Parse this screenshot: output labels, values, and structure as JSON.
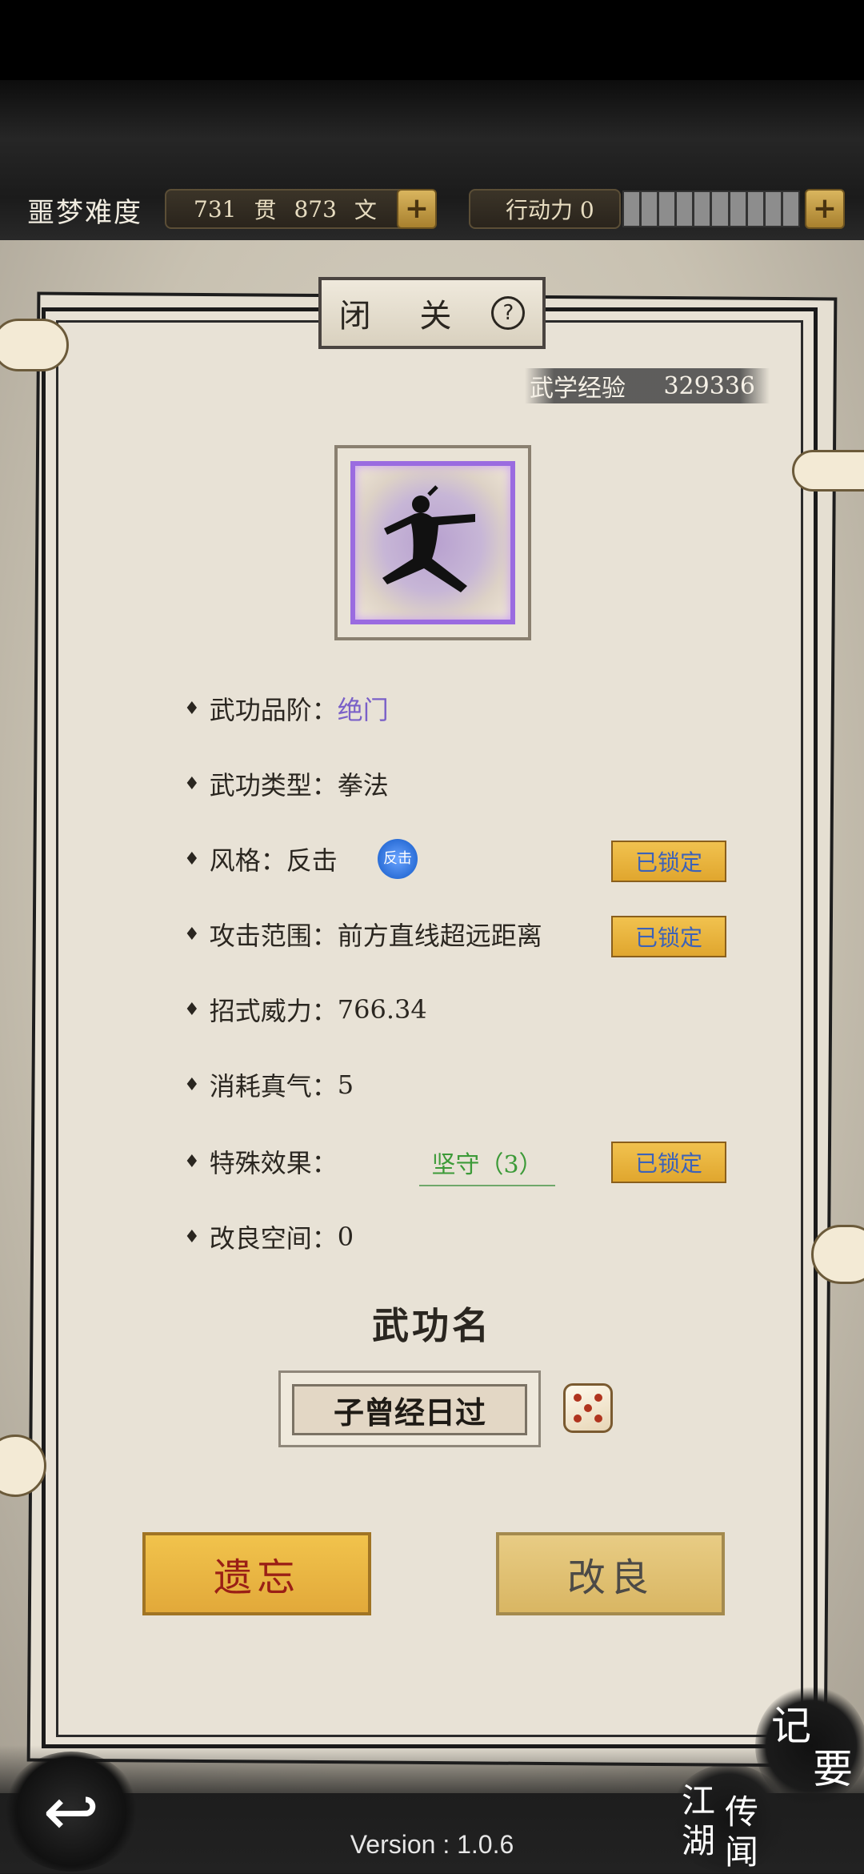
{
  "header": {
    "difficulty": "噩梦难度",
    "money": {
      "guan": "731",
      "guan_unit": "贯",
      "wen": "873",
      "wen_unit": "文"
    },
    "action_points_label": "行动力 0",
    "plus_icon": "+"
  },
  "panel": {
    "title": "闭 关",
    "help_icon": "?",
    "exp_label": "武学经验",
    "exp_value": "329336"
  },
  "attributes": [
    {
      "label": "武功品阶：",
      "value": "绝门"
    },
    {
      "label": "武功类型：",
      "value": "拳法"
    },
    {
      "label": "风格：",
      "value": "反击"
    },
    {
      "label": "攻击范围：",
      "value": "前方直线超远距离"
    },
    {
      "label": "招式威力：",
      "value": "766.34"
    },
    {
      "label": "消耗真气：",
      "value": "5"
    },
    {
      "label": "特殊效果：",
      "value": ""
    },
    {
      "label": "改良空间：",
      "value": "0"
    }
  ],
  "style_badge": "反击",
  "special_effect": "坚守（3）",
  "locked_label": "已锁定",
  "skill_name": {
    "title": "武功名",
    "value": "子曾经日过"
  },
  "buttons": {
    "forget": "遗忘",
    "improve": "改良"
  },
  "footer": {
    "back_icon": "↩",
    "version": "Version : 1.0.6",
    "notes": [
      "记",
      "要"
    ],
    "rumors": [
      "江",
      "湖",
      "传",
      "闻"
    ]
  },
  "colors": {
    "grade_purple": "#7a60c8",
    "effect_green": "#3c9a38",
    "lock_text": "#3c62b8",
    "gold_button": "#e2a93a",
    "forget_text": "#9a1f16"
  }
}
